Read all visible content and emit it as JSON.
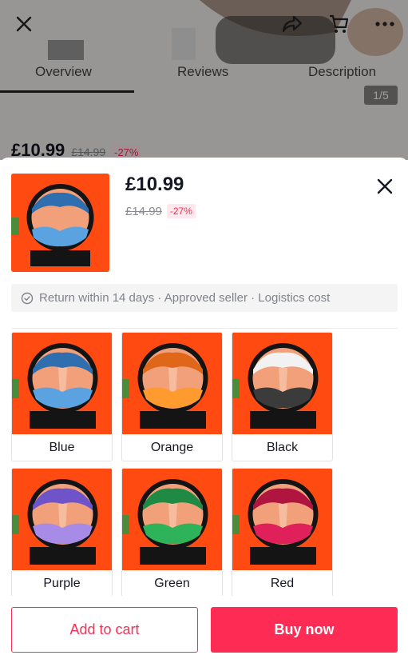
{
  "background": {
    "tabs": [
      "Overview",
      "Reviews",
      "Description"
    ],
    "pager": "1/5",
    "price": "£10.99",
    "original_price": "£14.99",
    "discount": "-27%"
  },
  "sheet": {
    "price": "£10.99",
    "original_price": "£14.99",
    "discount": "-27%",
    "policy": "Return within 14 days · Approved seller · Logistics cost"
  },
  "variants": [
    {
      "label": "Blue",
      "sand": "#5ba3e0",
      "sand2": "#2f6fb0"
    },
    {
      "label": "Orange",
      "sand": "#ff9a2e",
      "sand2": "#e0661a"
    },
    {
      "label": "Black",
      "sand": "#3b3b3b",
      "sand2": "#f2f2f2"
    },
    {
      "label": "Purple",
      "sand": "#a78be6",
      "sand2": "#6e54c8"
    },
    {
      "label": "Green",
      "sand": "#2fb35a",
      "sand2": "#1e8a43"
    },
    {
      "label": "Red",
      "sand": "#e0205a",
      "sand2": "#b01540"
    }
  ],
  "footer": {
    "add_to_cart": "Add to cart",
    "buy_now": "Buy now"
  },
  "colors": {
    "accent": "#fe2c55",
    "product_bg": "#ff4a12"
  }
}
